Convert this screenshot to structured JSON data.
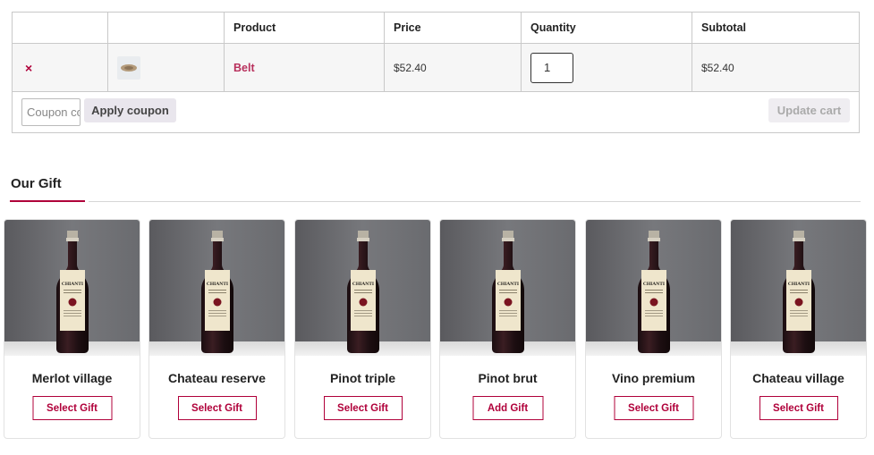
{
  "cart": {
    "headers": [
      "",
      "",
      "Product",
      "Price",
      "Quantity",
      "Subtotal"
    ],
    "item": {
      "remove_glyph": "×",
      "thumbnail_icon": "belt-thumbnail",
      "product": "Belt",
      "price": "$52.40",
      "quantity": "1",
      "subtotal": "$52.40"
    },
    "coupon": {
      "placeholder": "Coupon code",
      "apply_label": "Apply coupon",
      "update_label": "Update cart"
    }
  },
  "gift": {
    "title": "Our Gift",
    "items": [
      {
        "name": "Merlot village",
        "button": "Select Gift"
      },
      {
        "name": "Chateau reserve",
        "button": "Select Gift"
      },
      {
        "name": "Pinot triple",
        "button": "Select Gift"
      },
      {
        "name": "Pinot brut",
        "button": "Add Gift"
      },
      {
        "name": "Vino premium",
        "button": "Select Gift"
      },
      {
        "name": "Chateau village",
        "button": "Select Gift"
      }
    ],
    "bottle_label_text": "CHIANTI"
  },
  "colors": {
    "accent": "#b0003a",
    "product_link": "#b8305c",
    "border": "#c9c9c9"
  }
}
